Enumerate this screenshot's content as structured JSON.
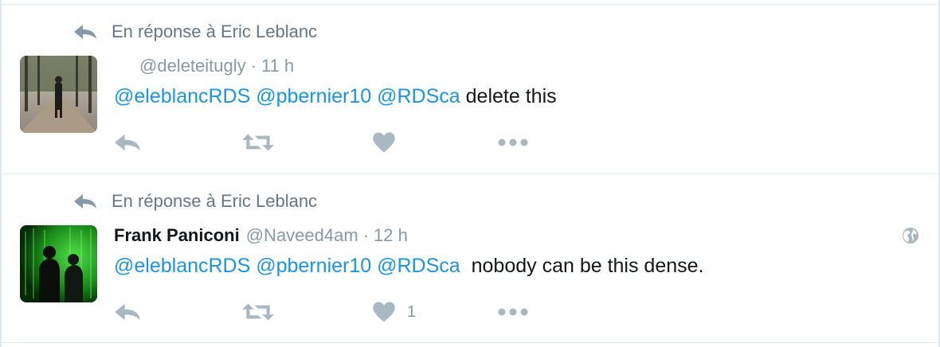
{
  "tweets": [
    {
      "context": "En réponse à Eric Leblanc",
      "fullname": "",
      "handle": "@deleteitugly",
      "separator": "·",
      "time": "11 h",
      "mentions": [
        "@eleblancRDS",
        "@pbernier10",
        "@RDSca"
      ],
      "body": "delete this",
      "like_count": ""
    },
    {
      "context": "En réponse à Eric Leblanc",
      "fullname": "Frank Paniconi",
      "handle": "@Naveed4am",
      "separator": "·",
      "time": "12 h",
      "mentions": [
        "@eleblancRDS",
        "@pbernier10",
        "@RDSca"
      ],
      "body": " nobody can be this dense.",
      "like_count": "1"
    }
  ],
  "icons": {
    "context": "reply-icon",
    "reply": "reply-icon",
    "retweet": "retweet-icon",
    "like": "heart-icon",
    "more": "more-icon",
    "visibility": "globe-icon"
  },
  "colors": {
    "mention": "#1b95e0",
    "muted": "#8899a6",
    "icon": "#aab8c2",
    "border": "#e1e8ed"
  }
}
